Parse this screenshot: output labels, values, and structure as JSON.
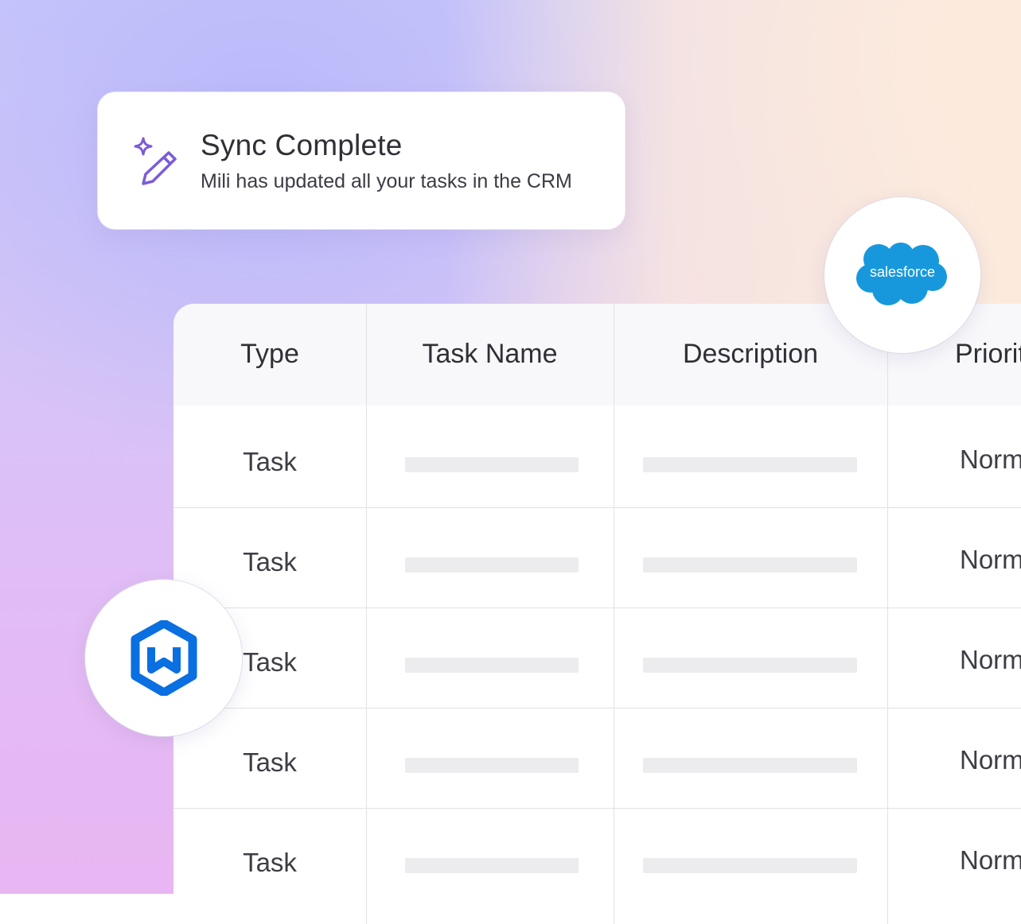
{
  "toast": {
    "title": "Sync Complete",
    "message": "Mili has updated all your tasks in the CRM",
    "icon": "sparkle-pencil-icon"
  },
  "table": {
    "columns": [
      "Type",
      "Task Name",
      "Description",
      "Priority"
    ],
    "rows": [
      {
        "type": "Task",
        "priority": "Normal"
      },
      {
        "type": "Task",
        "priority": "Normal"
      },
      {
        "type": "Task",
        "priority": "Normal"
      },
      {
        "type": "Task",
        "priority": "Normal"
      },
      {
        "type": "Task",
        "priority": "Normal"
      }
    ]
  },
  "integrations": {
    "salesforce": {
      "label": "salesforce",
      "color": "#1798dc",
      "icon": "salesforce-logo"
    },
    "wrike": {
      "icon": "wrike-logo",
      "color": "#0a6fe0"
    }
  },
  "colors": {
    "accent": "#7b5cd6",
    "text": "#2f2f36"
  }
}
